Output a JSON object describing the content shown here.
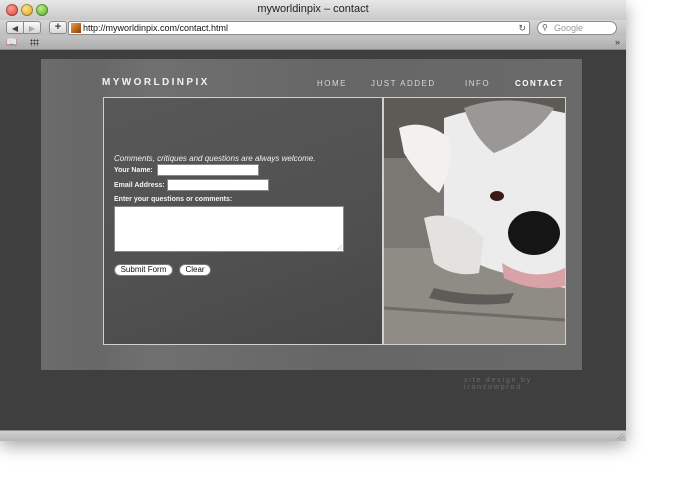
{
  "window": {
    "title": "myworldinpix – contact"
  },
  "toolbar": {
    "back_glyph": "◀",
    "forward_glyph": "▶",
    "add_glyph": "+",
    "url": "http://myworldinpix.com/contact.html",
    "reload_glyph": "↻",
    "search_placeholder": "Google",
    "search_glyph": "⚲"
  },
  "bookmarks": {
    "book_glyph": "📖",
    "more_glyph": "»"
  },
  "site": {
    "brand": "MYWORLDINPIX",
    "nav": [
      {
        "label": "HOME"
      },
      {
        "label": "JUST ADDED"
      },
      {
        "label": "INFO"
      },
      {
        "label": "CONTACT"
      }
    ],
    "credit": "site design by ironcowprod"
  },
  "form": {
    "intro": "Comments, critiques and questions are always welcome.",
    "name_label": "Your Name:",
    "email_label": "Email Address:",
    "comments_label": "Enter your questions or comments:",
    "name_value": "",
    "email_value": "",
    "comments_value": "",
    "submit_label": "Submit Form",
    "clear_label": "Clear"
  },
  "colors": {
    "page_background": "#3f3f3f",
    "panel": "#6b6b6b",
    "form_panel": "#555555",
    "active_nav": "#ffffff"
  }
}
